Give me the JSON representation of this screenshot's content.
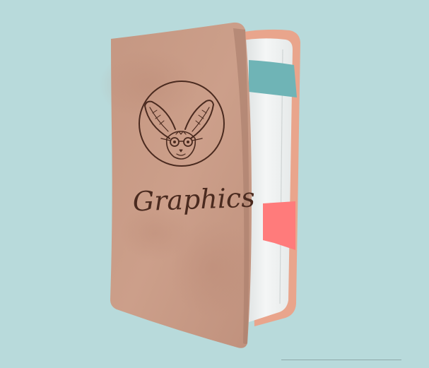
{
  "book": {
    "cover_title": "Graphics",
    "emblem": "fennec-fox-with-glasses-emblem",
    "colors": {
      "background": "#b8dadb",
      "cover": "#c89a85",
      "ink": "#4a2a1f",
      "teal_bookmark": "#6fb4b6",
      "pink_bookmark": "#ff7b7b",
      "back_cover": "#e9a58c"
    }
  }
}
